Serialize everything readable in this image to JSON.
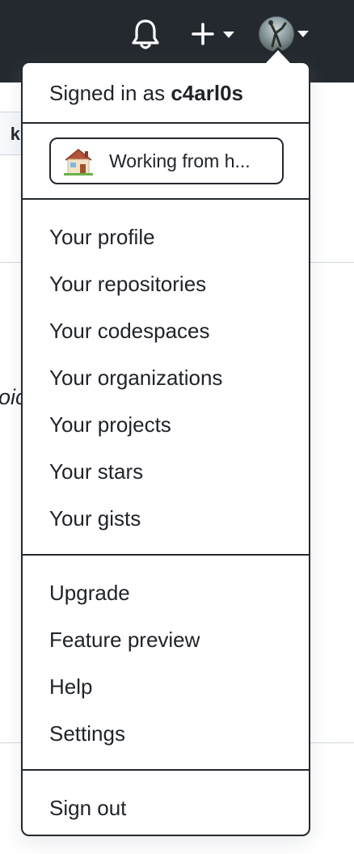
{
  "header": {
    "icons": [
      "bell-icon",
      "plus-icon",
      "avatar"
    ],
    "background_color": "#24292f"
  },
  "background": {
    "button_fragment": "k",
    "text_fragment": "oic"
  },
  "menu": {
    "signed_in_prefix": "Signed in as",
    "username": "c4arl0s",
    "status": {
      "emoji_icon": "house-icon",
      "text": "Working from h..."
    },
    "group1": [
      "Your profile",
      "Your repositories",
      "Your codespaces",
      "Your organizations",
      "Your projects",
      "Your stars",
      "Your gists"
    ],
    "group2": [
      "Upgrade",
      "Feature preview",
      "Help",
      "Settings"
    ],
    "sign_out": "Sign out"
  }
}
